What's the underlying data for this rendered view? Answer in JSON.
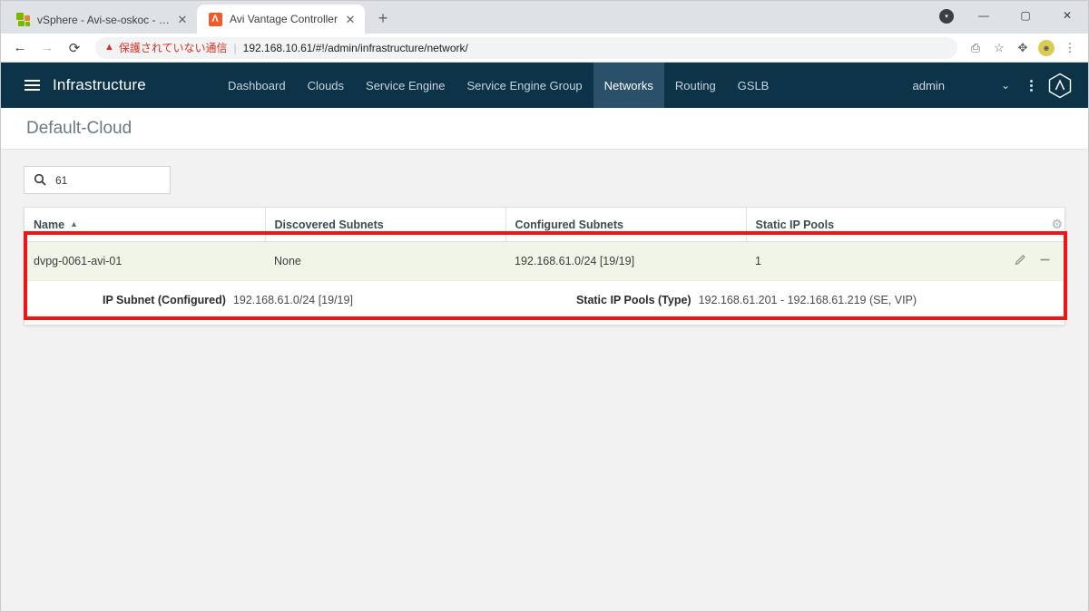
{
  "browser": {
    "tabs": [
      {
        "title": "vSphere - Avi-se-oskoc - サマリ",
        "favicon": "vsphere-icon",
        "active": false,
        "close_label": "✕"
      },
      {
        "title": "Avi Vantage Controller",
        "favicon": "avi-icon",
        "favicon_glyph": "Λ",
        "active": true,
        "close_label": "✕"
      }
    ],
    "new_tab_label": "+",
    "tab_search_glyph": "▾",
    "window_controls": {
      "minimize": "—",
      "maximize": "▢",
      "close": "✕"
    },
    "nav": {
      "back": "←",
      "forward": "→",
      "reload": "⟳"
    },
    "omnibox": {
      "warning_icon": "warning-triangle-icon",
      "warning_glyph": "▲",
      "security_text": "保護されていない通信",
      "separator": "|",
      "url": "192.168.10.61/#!/admin/infrastructure/network/"
    },
    "toolbar_icons": {
      "translate": "⎙",
      "bookmark": "☆",
      "extensions": "✥",
      "avatar": "☻",
      "menu": "⋮"
    }
  },
  "appnav": {
    "menu_icon": "hamburger-icon",
    "title": "Infrastructure",
    "links": [
      {
        "label": "Dashboard",
        "active": false
      },
      {
        "label": "Clouds",
        "active": false
      },
      {
        "label": "Service Engine",
        "active": false
      },
      {
        "label": "Service Engine Group",
        "active": false
      },
      {
        "label": "Networks",
        "active": true
      },
      {
        "label": "Routing",
        "active": false
      },
      {
        "label": "GSLB",
        "active": false
      }
    ],
    "user": "admin",
    "chevron": "⌄",
    "kebab": "⋮",
    "logo": "avi-logo-icon",
    "bg_color": "#0d3349",
    "active_tab_color": "#2a506a"
  },
  "page": {
    "title": "Default-Cloud",
    "search": {
      "icon": "search-icon",
      "value": "61",
      "placeholder": "Search"
    }
  },
  "table": {
    "columns": [
      {
        "label": "Name",
        "sorted": true,
        "sort_glyph": "▲"
      },
      {
        "label": "Discovered Subnets",
        "sorted": false
      },
      {
        "label": "Configured Subnets",
        "sorted": false
      },
      {
        "label": "Static IP Pools",
        "sorted": false
      }
    ],
    "settings_icon": "gear-icon",
    "settings_glyph": "⚙",
    "rows": [
      {
        "name": "dvpg-0061-avi-01",
        "discovered_subnets": "None",
        "configured_subnets": "192.168.61.0/24 [19/19]",
        "static_ip_pools": "1",
        "edit_icon": "pencil-icon",
        "delete_icon": "minus-icon",
        "expanded": true,
        "details": [
          {
            "label": "IP Subnet (Configured)",
            "value": "192.168.61.0/24 [19/19]"
          },
          {
            "label": "Static IP Pools (Type)",
            "value": "192.168.61.201 - 192.168.61.219 (SE, VIP)"
          }
        ]
      }
    ]
  },
  "annotation": {
    "highlight_color": "#f01414"
  }
}
